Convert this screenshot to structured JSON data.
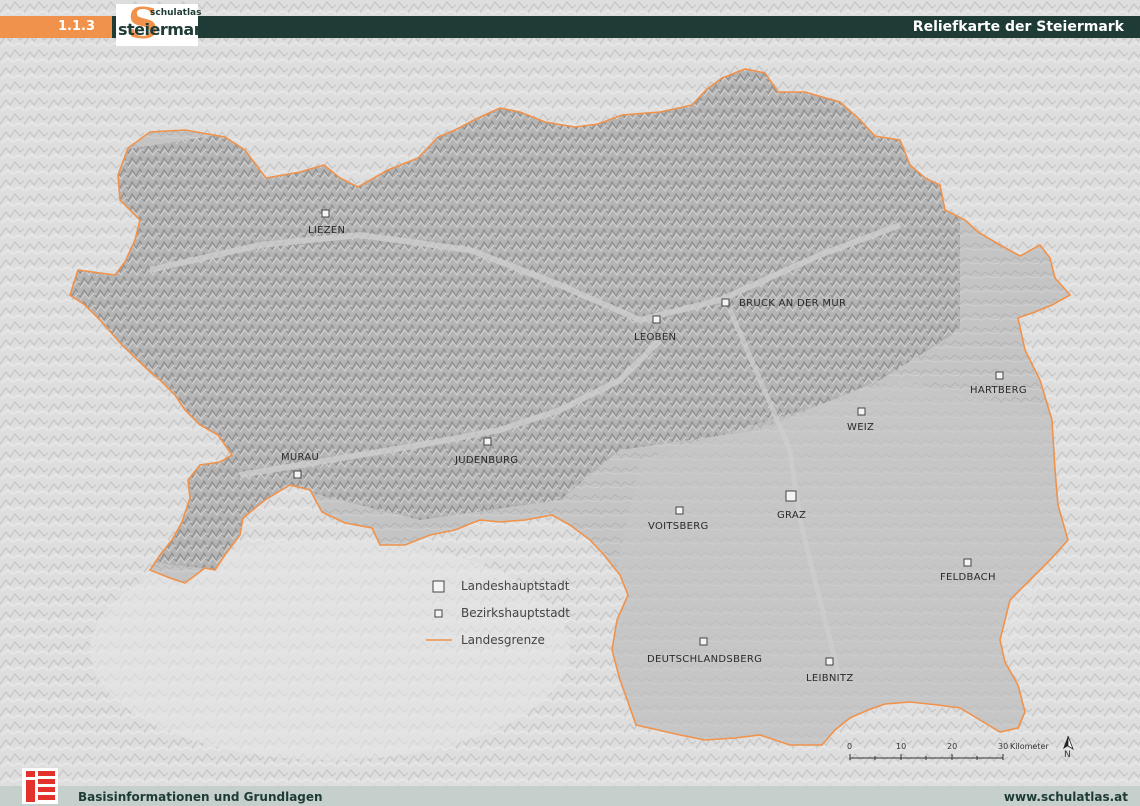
{
  "header": {
    "map_number": "1.1.3",
    "logo_small": "schulatlas",
    "logo_big": "steiermark",
    "logo_letter": "S",
    "title": "Reliefkarte der Steiermark"
  },
  "colors": {
    "header_dark": "#1f3b36",
    "header_orange": "#f0924b",
    "border": "#f0924b",
    "relief_base": "#dcdcdc",
    "region_fill": "#bdbdbd"
  },
  "cities": [
    {
      "name": "LIEZEN",
      "type": "Bezirkshauptstadt"
    },
    {
      "name": "BRUCK AN DER MUR",
      "type": "Bezirkshauptstadt"
    },
    {
      "name": "LEOBEN",
      "type": "Bezirkshauptstadt"
    },
    {
      "name": "HARTBERG",
      "type": "Bezirkshauptstadt"
    },
    {
      "name": "WEIZ",
      "type": "Bezirkshauptstadt"
    },
    {
      "name": "MURAU",
      "type": "Bezirkshauptstadt"
    },
    {
      "name": "JUDENBURG",
      "type": "Bezirkshauptstadt"
    },
    {
      "name": "VOITSBERG",
      "type": "Bezirkshauptstadt"
    },
    {
      "name": "GRAZ",
      "type": "Landeshauptstadt"
    },
    {
      "name": "FELDBACH",
      "type": "Bezirkshauptstadt"
    },
    {
      "name": "DEUTSCHLANDSBERG",
      "type": "Bezirkshauptstadt"
    },
    {
      "name": "LEIBNITZ",
      "type": "Bezirkshauptstadt"
    }
  ],
  "legend": [
    {
      "label": "Landeshauptstadt",
      "symbol": "large-square"
    },
    {
      "label": "Bezirkshauptstadt",
      "symbol": "small-square"
    },
    {
      "label": "Landesgrenze",
      "symbol": "orange-line"
    }
  ],
  "scale": {
    "ticks": [
      "0",
      "10",
      "20",
      "30"
    ],
    "unit": "Kilometer"
  },
  "north_arrow": "N",
  "footer": {
    "left": "Basisinformationen und Grundlagen",
    "right": "www.schulatlas.at"
  }
}
